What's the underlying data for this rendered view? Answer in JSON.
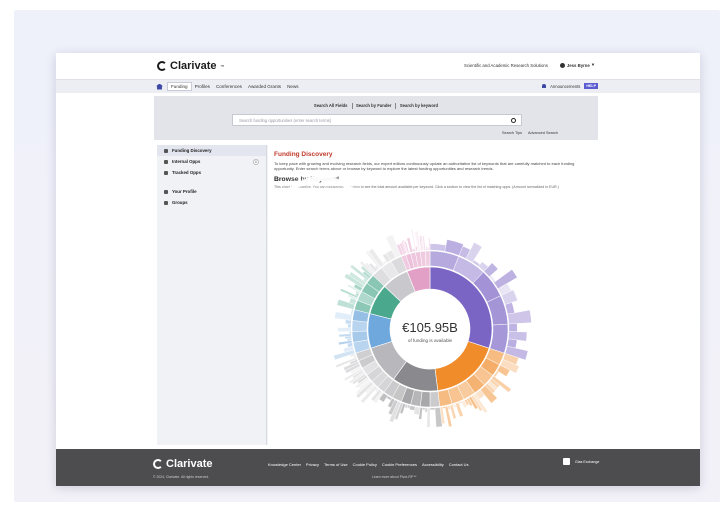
{
  "header": {
    "brand": "Clarivate",
    "brand_mark": "™",
    "product": "Scientific and Academic Research Solutions",
    "user": "Jess Byrne",
    "user_icon": "user-icon"
  },
  "nav": {
    "items": [
      "Funding",
      "Profiles",
      "Conferences",
      "Awarded Grants",
      "News"
    ],
    "announcements": "Announcements",
    "help": "HELP"
  },
  "search": {
    "tabs": [
      "Search All Fields",
      "Search by Funder",
      "Search by keyword"
    ],
    "placeholder": "Search funding opportunities (enter search terms)",
    "tips": "Search Tips",
    "advanced": "Advanced Search"
  },
  "sidebar": {
    "items": [
      {
        "label": "Funding Discovery",
        "active": true
      },
      {
        "label": "Internal Opps",
        "badge": "i"
      },
      {
        "label": "Tracked Opps"
      },
      {
        "label": "Your Profile"
      },
      {
        "label": "Groups"
      }
    ]
  },
  "main": {
    "title": "Funding Discovery",
    "description": "To keep pace with growing and evolving research fields, our expert editors continuously update an authoritative list of keywords that are carefully matched to each funding opportunity. Enter search terms above or browse by keyword to explore the latest funding opportunities and research trends.",
    "browse_title": "Browse by Keyword",
    "browse_desc": "This chart is interactive. You can mouseover a section to see the total amount available per keyword. Click a section to view the list of matching opps. (Amount normalized in EUR.)",
    "center_amount": "€105.95B",
    "center_label": "of funding is available"
  },
  "chart_data": {
    "type": "pie",
    "variant": "sunburst",
    "center_value": "€105.95B",
    "inner_ring": [
      {
        "value": 30,
        "color": "#7a64c4"
      },
      {
        "value": 18,
        "color": "#f08c2a"
      },
      {
        "value": 12,
        "color": "#8a8a8e"
      },
      {
        "value": 10,
        "color": "#b8b8bc"
      },
      {
        "value": 9,
        "color": "#6fa8dc"
      },
      {
        "value": 8,
        "color": "#4aa88c"
      },
      {
        "value": 7,
        "color": "#c9c9cd"
      },
      {
        "value": 6,
        "color": "#e2a0c7"
      }
    ]
  },
  "footer": {
    "brand": "Clarivate",
    "copyright": "© 2024, Clarivate. All rights reserved.",
    "links": [
      "Knowledge Center",
      "Privacy",
      "Terms of Use",
      "Cookie Policy",
      "Cookie Preferences",
      "Accessibility",
      "Contact Us"
    ],
    "sub": "Learn more about Pivot-RP™",
    "orcid": "Glas Exchange"
  }
}
